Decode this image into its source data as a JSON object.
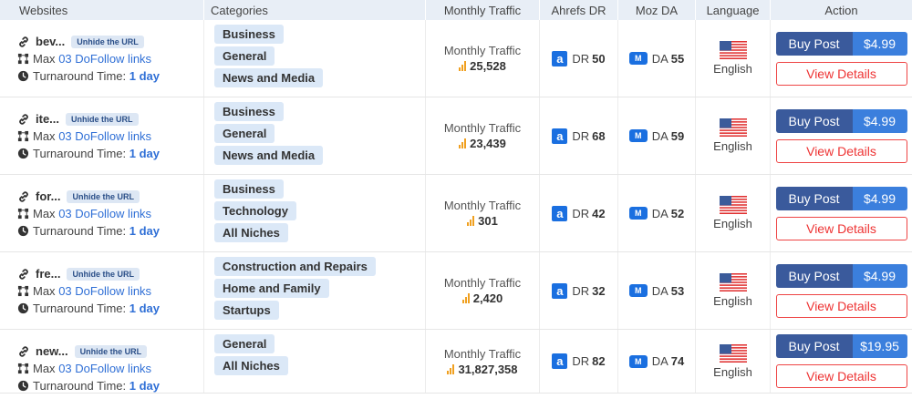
{
  "header": {
    "websites": "Websites",
    "categories": "Categories",
    "traffic": "Monthly Traffic",
    "ahrefs": "Ahrefs DR",
    "moz": "Moz DA",
    "language": "Language",
    "action": "Action"
  },
  "labels": {
    "unhide": "Unhide the URL",
    "max": "Max",
    "links": "03 DoFollow links",
    "turnaround": "Turnaround Time:",
    "turnaround_value": "1 day",
    "monthly_traffic": "Monthly Traffic",
    "dr_prefix": "DR",
    "da_prefix": "DA",
    "ahrefs_letter": "a",
    "moz_letter": "M",
    "buy_post": "Buy Post",
    "view_details": "View Details"
  },
  "rows": [
    {
      "site": "bev...",
      "categories": [
        "Business",
        "General",
        "News and Media"
      ],
      "traffic": "25,528",
      "dr": "50",
      "da": "55",
      "language": "English",
      "price": "$4.99"
    },
    {
      "site": "ite...",
      "categories": [
        "Business",
        "General",
        "News and Media"
      ],
      "traffic": "23,439",
      "dr": "68",
      "da": "59",
      "language": "English",
      "price": "$4.99"
    },
    {
      "site": "for...",
      "categories": [
        "Business",
        "Technology",
        "All Niches"
      ],
      "traffic": "301",
      "dr": "42",
      "da": "52",
      "language": "English",
      "price": "$4.99"
    },
    {
      "site": "fre...",
      "categories": [
        "Construction and Repairs",
        "Home and Family",
        "Startups"
      ],
      "traffic": "2,420",
      "dr": "32",
      "da": "53",
      "language": "English",
      "price": "$4.99"
    },
    {
      "site": "new...",
      "categories": [
        "General",
        "All Niches"
      ],
      "traffic": "31,827,358",
      "dr": "82",
      "da": "74",
      "language": "English",
      "price": "$19.95"
    }
  ],
  "colors": {
    "buy_dark": "#3a5a9c",
    "buy_light": "#3b7fdd",
    "view_red": "#e33",
    "accent_blue": "#2f6fd6",
    "traffic_orange": "#f0a020"
  }
}
